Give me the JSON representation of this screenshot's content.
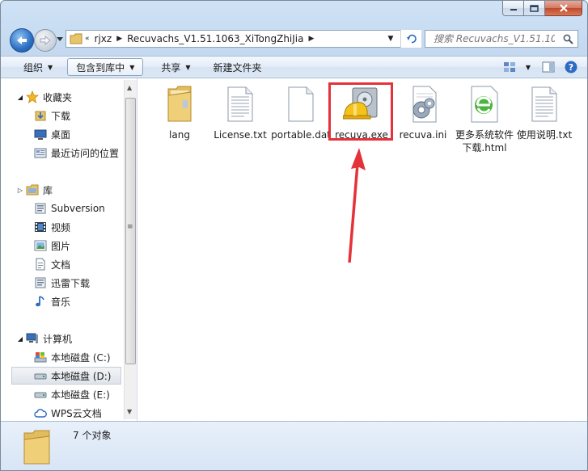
{
  "window": {
    "caption": {
      "minimize": "minimize",
      "maximize": "maximize",
      "close": "close"
    }
  },
  "nav": {
    "overflow": "«",
    "breadcrumb": [
      "rjxz",
      "Recuvachs_V1.51.1063_XiTongZhiJia"
    ],
    "search_placeholder": "搜索 Recuvachs_V1.51.10..."
  },
  "toolbar": {
    "organize": "组织",
    "include_library": "包含到库中",
    "share": "共享",
    "new_folder": "新建文件夹"
  },
  "sidebar": {
    "favorites": {
      "label": "收藏夹",
      "items": [
        "下载",
        "桌面",
        "最近访问的位置"
      ]
    },
    "libraries": {
      "label": "库",
      "items": [
        "Subversion",
        "视频",
        "图片",
        "文档",
        "迅雷下载",
        "音乐"
      ]
    },
    "computer": {
      "label": "计算机",
      "items": [
        "本地磁盘 (C:)",
        "本地磁盘 (D:)",
        "本地磁盘 (E:)",
        "WPS云文档"
      ]
    }
  },
  "files": [
    {
      "name": "lang",
      "icon": "folder-icon"
    },
    {
      "name": "License.txt",
      "icon": "text-file-icon"
    },
    {
      "name": "portable.dat",
      "icon": "blank-file-icon"
    },
    {
      "name": "recuva.exe",
      "icon": "recuva-app-icon"
    },
    {
      "name": "recuva.ini",
      "icon": "settings-file-icon"
    },
    {
      "name": "更多系统软件下载.html",
      "icon": "ie-html-icon"
    },
    {
      "name": "使用说明.txt",
      "icon": "text-file-icon"
    }
  ],
  "status": {
    "count": "7 个对象"
  },
  "colors": {
    "highlight": "#e5323a",
    "window_frame": "#bcd3ee",
    "selection": "#dfe4ea"
  }
}
